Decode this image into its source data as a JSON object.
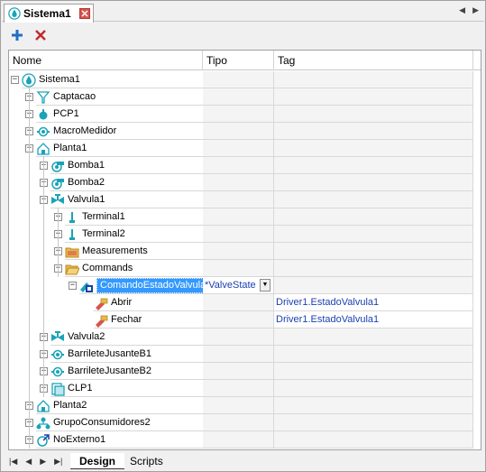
{
  "window": {
    "tab_title": "Sistema1",
    "nav_left": "◀",
    "nav_right": "▶"
  },
  "toolbar": {
    "add_icon": "plus-icon",
    "delete_icon": "x-icon"
  },
  "columns": [
    "Nome",
    "Tipo",
    "Tag"
  ],
  "tree": [
    {
      "label": "Sistema1",
      "icon": "drop",
      "expanded": true,
      "tipo": "",
      "tag": ""
    },
    {
      "label": "Captacao",
      "icon": "funnel",
      "expanded": false,
      "tipo": "",
      "tag": ""
    },
    {
      "label": "PCP1",
      "icon": "pcp",
      "expanded": false,
      "tipo": "",
      "tag": ""
    },
    {
      "label": "MacroMedidor",
      "icon": "meter",
      "expanded": false,
      "tipo": "",
      "tag": ""
    },
    {
      "label": "Planta1",
      "icon": "house",
      "expanded": true,
      "tipo": "",
      "tag": ""
    },
    {
      "label": "Bomba1",
      "icon": "pump",
      "expanded": false,
      "tipo": "",
      "tag": ""
    },
    {
      "label": "Bomba2",
      "icon": "pump",
      "expanded": false,
      "tipo": "",
      "tag": ""
    },
    {
      "label": "Valvula1",
      "icon": "valve",
      "expanded": true,
      "tipo": "",
      "tag": ""
    },
    {
      "label": "Terminal1",
      "icon": "terminal",
      "expanded": false,
      "tipo": "",
      "tag": ""
    },
    {
      "label": "Terminal2",
      "icon": "terminal",
      "expanded": false,
      "tipo": "",
      "tag": ""
    },
    {
      "label": "Measurements",
      "icon": "folder",
      "expanded": false,
      "tipo": "",
      "tag": ""
    },
    {
      "label": "Commands",
      "icon": "folder-open",
      "expanded": true,
      "tipo": "",
      "tag": ""
    },
    {
      "label": "ComandoEstadoValvula",
      "icon": "command",
      "expanded": true,
      "tipo": "*ValveState",
      "tag": "",
      "selected": true
    },
    {
      "label": "Abrir",
      "icon": "cmd-item",
      "tipo": "",
      "tag": "Driver1.EstadoValvula1"
    },
    {
      "label": "Fechar",
      "icon": "cmd-item",
      "tipo": "",
      "tag": "Driver1.EstadoValvula1"
    },
    {
      "label": "Valvula2",
      "icon": "valve",
      "expanded": false,
      "tipo": "",
      "tag": ""
    },
    {
      "label": "BarrileteJusanteB1",
      "icon": "meter",
      "expanded": false,
      "tipo": "",
      "tag": ""
    },
    {
      "label": "BarrileteJusanteB2",
      "icon": "meter",
      "expanded": false,
      "tipo": "",
      "tag": ""
    },
    {
      "label": "CLP1",
      "icon": "clp",
      "expanded": false,
      "tipo": "",
      "tag": ""
    },
    {
      "label": "Planta2",
      "icon": "house",
      "expanded": false,
      "tipo": "",
      "tag": ""
    },
    {
      "label": "GrupoConsumidores2",
      "icon": "group",
      "expanded": false,
      "tipo": "",
      "tag": ""
    },
    {
      "label": "NoExterno1",
      "icon": "external",
      "expanded": false,
      "tipo": "",
      "tag": ""
    }
  ],
  "bottom_tabs": [
    "Design",
    "Scripts"
  ],
  "colors": {
    "selection": "#3399ff",
    "link": "#1a3fb0",
    "accent_teal": "#1aa3b8"
  }
}
